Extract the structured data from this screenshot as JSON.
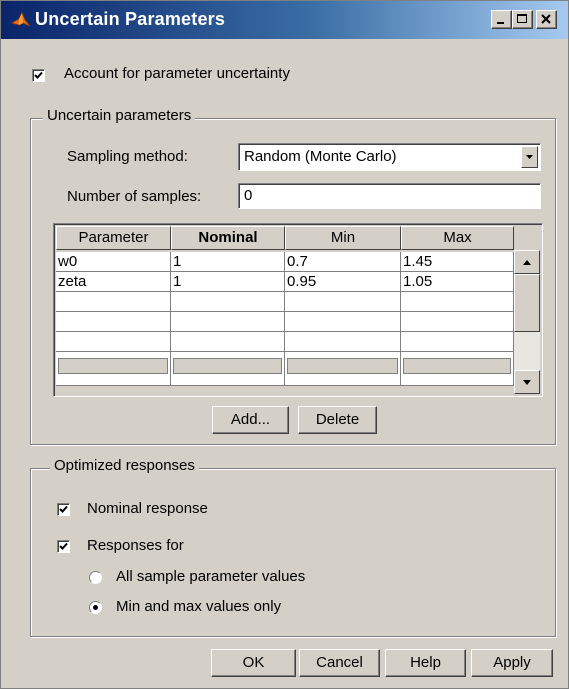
{
  "window": {
    "title": "Uncertain Parameters",
    "icon": "matlab-icon",
    "controls": [
      "minimize-icon",
      "maximize-icon",
      "close-icon"
    ]
  },
  "account_checkbox": {
    "label": "Account for parameter uncertainty",
    "checked": true
  },
  "uncertain_group": {
    "title": "Uncertain parameters",
    "sampling_label": "Sampling method:",
    "sampling_value": "Random (Monte Carlo)",
    "samples_label": "Number of samples:",
    "samples_value": "0",
    "table": {
      "columns": [
        "Parameter",
        "Nominal",
        "Min",
        "Max"
      ],
      "bold_column": "Nominal",
      "rows": [
        [
          "w0",
          "1",
          "0.7",
          "1.45"
        ],
        [
          "zeta",
          "1",
          "0.95",
          "1.05"
        ],
        [
          "",
          "",
          "",
          ""
        ],
        [
          "",
          "",
          "",
          ""
        ],
        [
          "",
          "",
          "",
          ""
        ]
      ]
    },
    "add_label": "Add...",
    "delete_label": "Delete"
  },
  "optimized_group": {
    "title": "Optimized responses",
    "nominal": {
      "label": "Nominal response",
      "checked": true
    },
    "responses_for": {
      "label": "Responses for",
      "checked": true
    },
    "options": [
      {
        "label": "All sample parameter values",
        "selected": false
      },
      {
        "label": "Min and max values only",
        "selected": true
      }
    ]
  },
  "buttons": {
    "ok": "OK",
    "cancel": "Cancel",
    "help": "Help",
    "apply": "Apply"
  }
}
